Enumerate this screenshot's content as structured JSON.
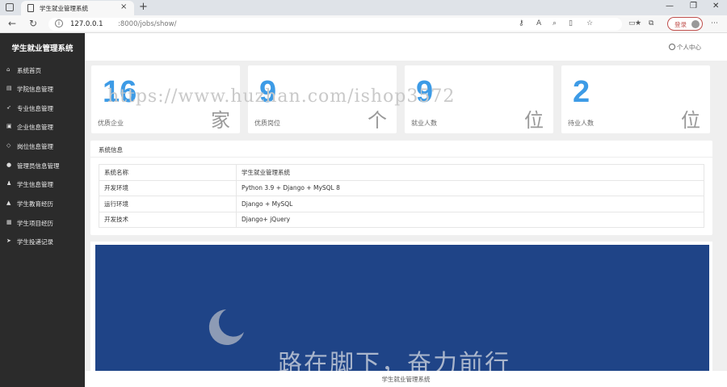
{
  "browser": {
    "tab_title": "学生就业管理系统",
    "url_host": "127.0.0.1",
    "url_path": ":8000/jobs/show/",
    "login_label": "登录"
  },
  "sidebar": {
    "brand": "学生就业管理系统",
    "items": [
      {
        "label": "系统首页",
        "icon": "home-icon"
      },
      {
        "label": "学院信息管理",
        "icon": "book-icon"
      },
      {
        "label": "专业信息管理",
        "icon": "rocket-icon"
      },
      {
        "label": "企业信息管理",
        "icon": "card-icon"
      },
      {
        "label": "岗位信息管理",
        "icon": "diamond-icon"
      },
      {
        "label": "管理员信息管理",
        "icon": "user-icon"
      },
      {
        "label": "学生信息管理",
        "icon": "users-icon"
      },
      {
        "label": "学生教育经历",
        "icon": "graduation-icon"
      },
      {
        "label": "学生项目经历",
        "icon": "keyboard-icon"
      },
      {
        "label": "学生投递记录",
        "icon": "send-icon"
      }
    ]
  },
  "header": {
    "user_center": "个人中心",
    "watermark": "https://www.huzhan.com/ishop3572"
  },
  "stats": [
    {
      "value": "16",
      "label": "优质企业",
      "unit": "家"
    },
    {
      "value": "9",
      "label": "优质岗位",
      "unit": "个"
    },
    {
      "value": "9",
      "label": "就业人数",
      "unit": "位"
    },
    {
      "value": "2",
      "label": "待业人数",
      "unit": "位"
    }
  ],
  "sysinfo": {
    "title": "系统信息",
    "rows": [
      {
        "key": "系统名称",
        "value": "学生就业管理系统"
      },
      {
        "key": "开发环境",
        "value": "Python 3.9 + Django + MySQL 8"
      },
      {
        "key": "运行环境",
        "value": "Django + MySQL"
      },
      {
        "key": "开发技术",
        "value": "Django+ jQuery"
      }
    ]
  },
  "banner": {
    "slogan": "路在脚下，奋力前行"
  },
  "footer": {
    "text": "学生就业管理系统"
  },
  "colors": {
    "accent": "#3d9be6",
    "sidebar_bg": "#2b2b2b",
    "banner_bg": "#1f4487",
    "login_red": "#c0504d"
  }
}
